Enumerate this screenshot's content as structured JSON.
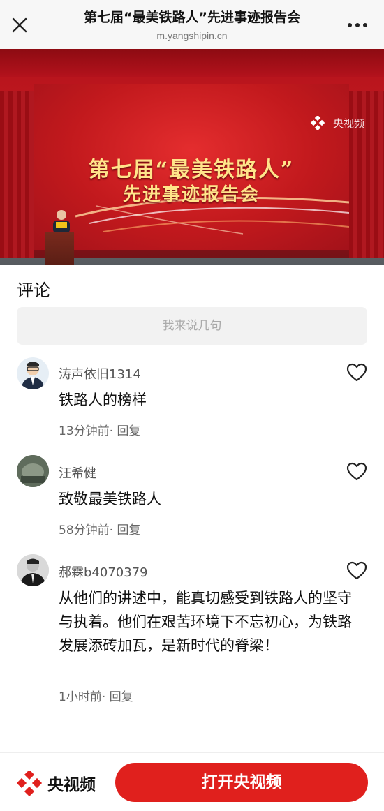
{
  "header": {
    "title": "第七届“最美铁路人”先进事迹报告会",
    "url": "m.yangshipin.cn",
    "close_icon": "close-icon",
    "more_icon": "more-dots-icon"
  },
  "video": {
    "screen_title_line1": "第七届“最美铁路人”",
    "screen_title_line2": "先进事迹报告会",
    "watermark": "央视频"
  },
  "comments_section": {
    "heading": "评论",
    "input_placeholder": "我来说几句",
    "items": [
      {
        "username": "涛声依旧1314",
        "content": "铁路人的榜样",
        "time": "13分钟前",
        "separator": "·",
        "reply": "回复"
      },
      {
        "username": "汪希健",
        "content": "致敬最美铁路人",
        "time": "58分钟前",
        "separator": "·",
        "reply": "回复"
      },
      {
        "username": "郝霖b4070379",
        "content": "从他们的讲述中，能真切感受到铁路人的坚守与执着。他们在艰苦环境下不忘初心，为铁路发展添砖加瓦，是新时代的脊梁！",
        "time": "1小时前",
        "separator": "·",
        "reply": "回复"
      }
    ]
  },
  "bottom_bar": {
    "brand": "央视频",
    "open_button": "打开央视频"
  },
  "colors": {
    "accent": "#e0201d",
    "topbar_bg": "#f7f7f7",
    "input_bg": "#f2f2f2"
  }
}
